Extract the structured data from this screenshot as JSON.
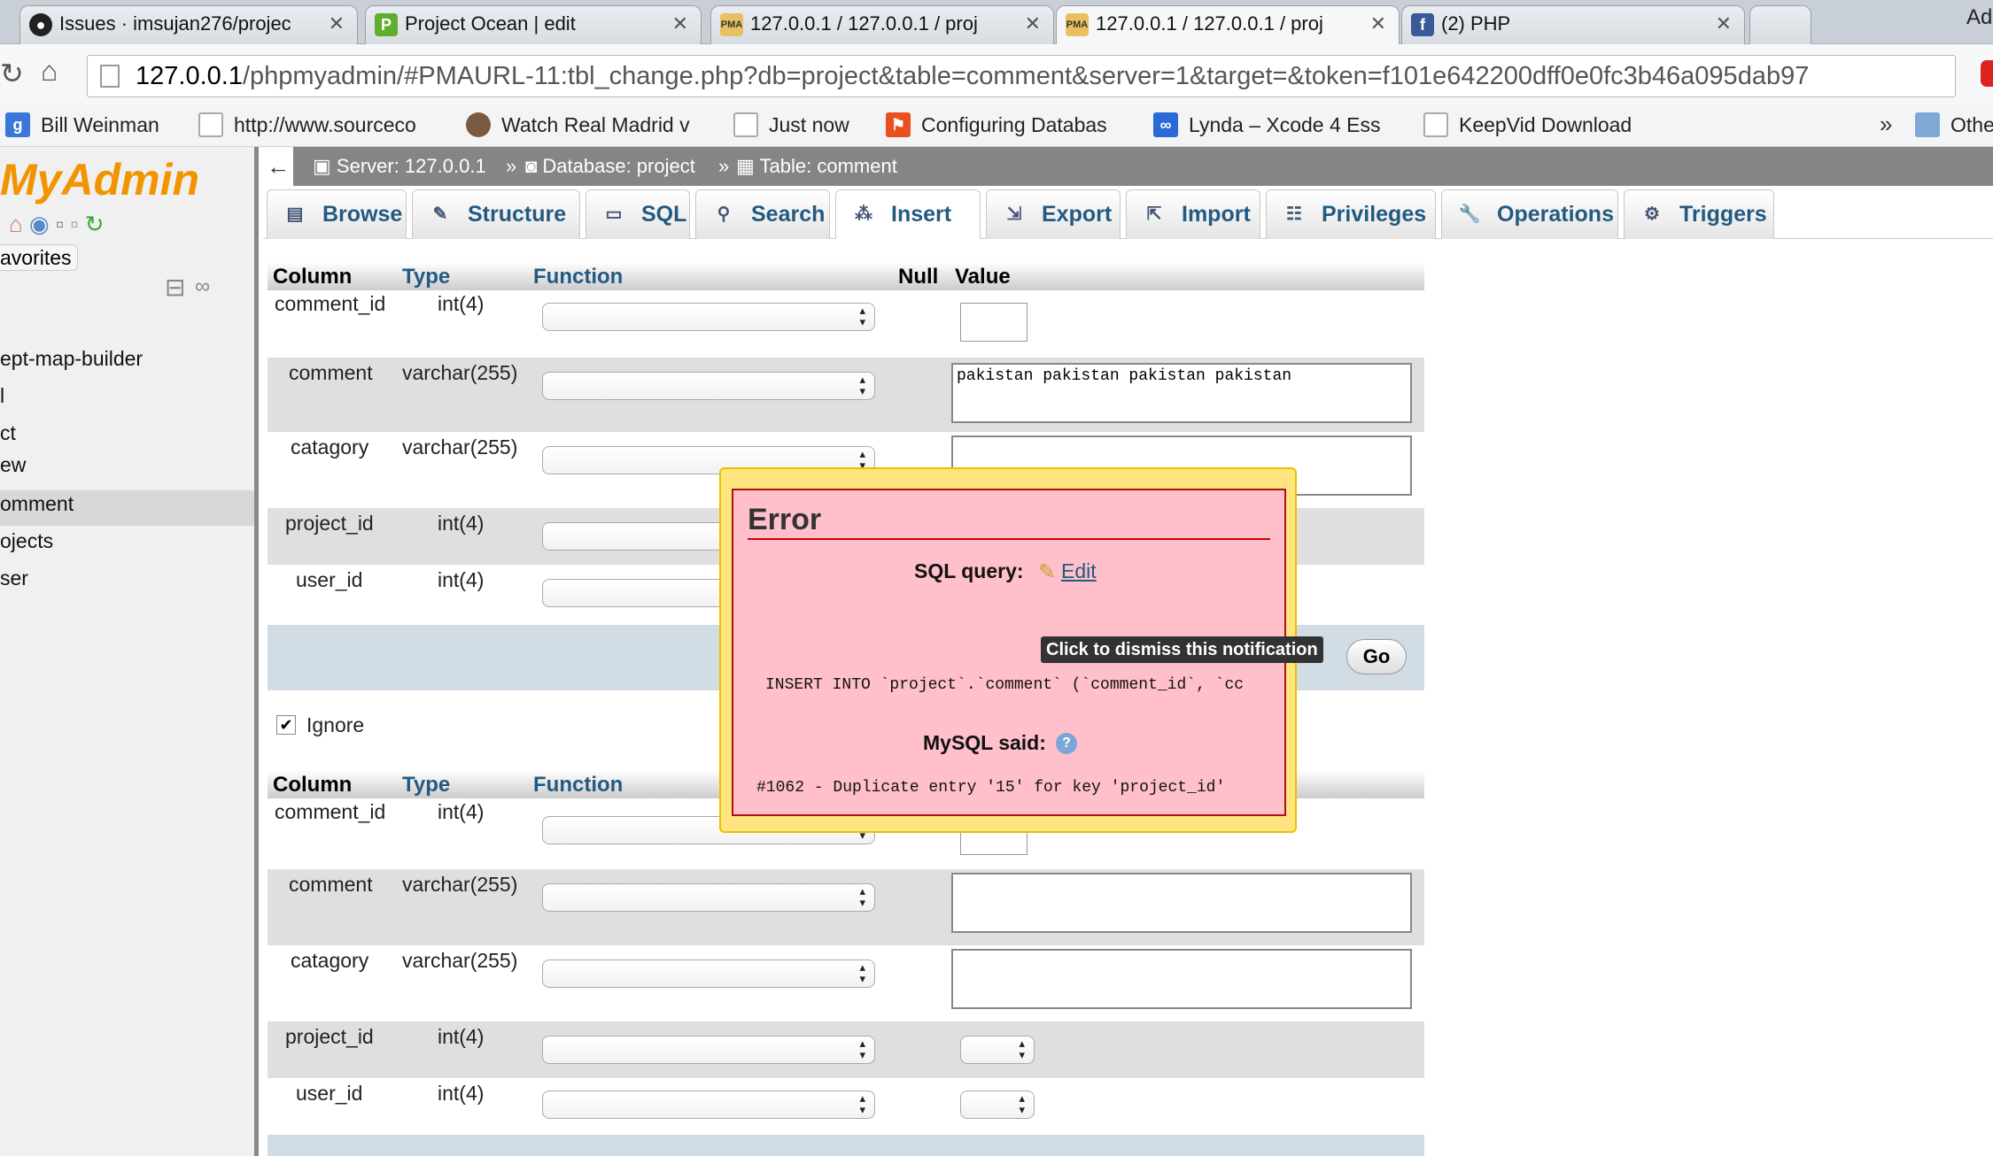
{
  "browser": {
    "tabs": [
      {
        "label": "Issues · imsujan276/projec",
        "icon": "github-icon"
      },
      {
        "label": "Project Ocean | edit",
        "icon": "p-icon"
      },
      {
        "label": "127.0.0.1 / 127.0.0.1 / proj",
        "icon": "pma-icon"
      },
      {
        "label": "127.0.0.1 / 127.0.0.1 / proj",
        "icon": "pma-icon"
      },
      {
        "label": "(2) PHP",
        "icon": "facebook-icon"
      }
    ],
    "url_host": "127.0.0.1",
    "url_rest": "/phpmyadmin/#PMAURL-11:tbl_change.php?db=project&table=comment&server=1&target=&token=f101e642200dff0e0fc3b46a095dab97",
    "corner_label": "Ad",
    "bookmarks": [
      "Bill Weinman",
      "http://www.sourceco",
      "Watch Real Madrid v",
      "Just now",
      "Configuring Databas",
      "Lynda – Xcode 4 Ess",
      "KeepVid Download"
    ],
    "bookmarks_overflow": "»",
    "other_bookmarks": "Othe"
  },
  "sidebar": {
    "logo": "MyAdmin",
    "favorites": "avorites",
    "items": [
      "ept-map-builder",
      "l",
      "ct",
      "ew",
      "omment",
      "ojects",
      "ser"
    ]
  },
  "topbar": {
    "server": "Server: 127.0.0.1",
    "database": "Database: project",
    "table": "Table: comment",
    "sep": "»"
  },
  "tabs": [
    "Browse",
    "Structure",
    "SQL",
    "Search",
    "Insert",
    "Export",
    "Import",
    "Privileges",
    "Operations",
    "Triggers"
  ],
  "headers": {
    "column": "Column",
    "type": "Type",
    "function": "Function",
    "null": "Null",
    "value": "Value"
  },
  "rows": [
    {
      "column": "comment_id",
      "type": "int(4)"
    },
    {
      "column": "comment",
      "type": "varchar(255)"
    },
    {
      "column": "catagory",
      "type": "varchar(255)"
    },
    {
      "column": "project_id",
      "type": "int(4)"
    },
    {
      "column": "user_id",
      "type": "int(4)"
    }
  ],
  "first_comment_value": "pakistan pakistan pakistan pakistan",
  "ignore_label": "Ignore",
  "go_label": "Go",
  "error": {
    "title": "Error",
    "sql_query_label": "SQL query:",
    "edit_label": "Edit",
    "query": "INSERT INTO `project`.`comment` (`comment_id`, `cc",
    "mysql_said": "MySQL said:",
    "message": "#1062 - Duplicate entry '15' for key 'project_id'"
  },
  "tooltip": "Click to dismiss this notification"
}
